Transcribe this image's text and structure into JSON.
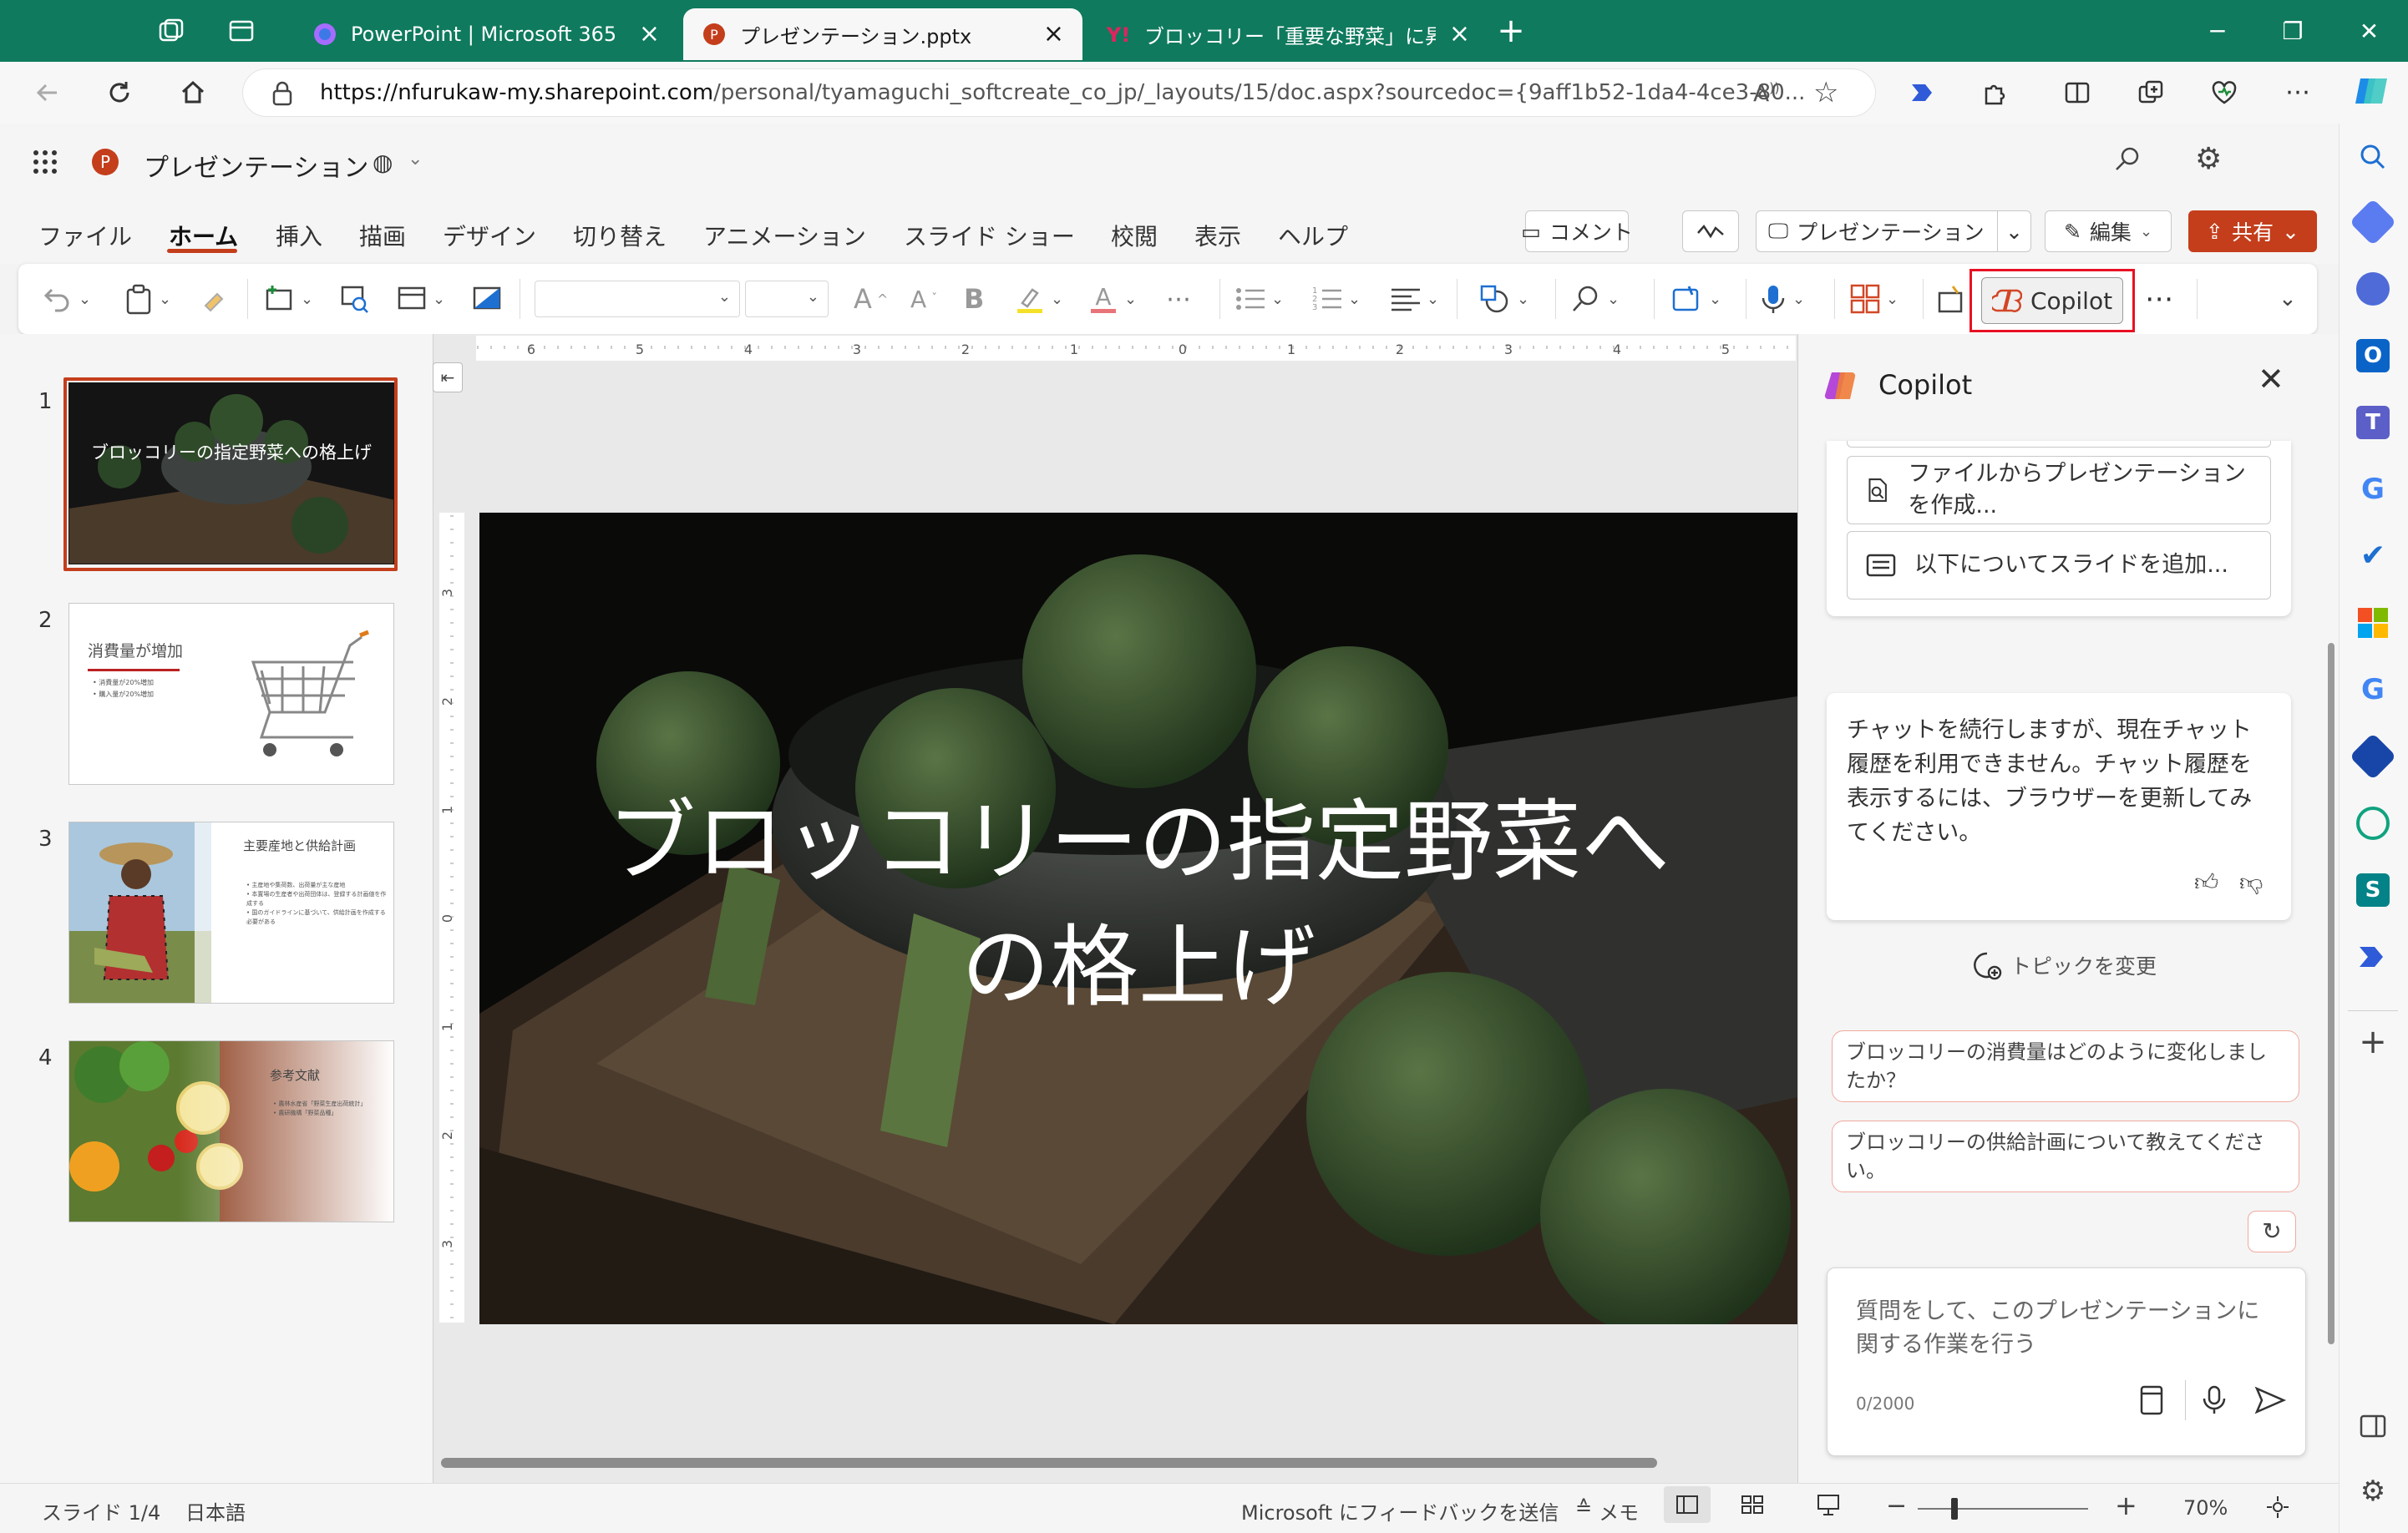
{
  "browser": {
    "tabs": [
      {
        "title": "PowerPoint | Microsoft 365"
      },
      {
        "title": "プレゼンテーション.pptx"
      },
      {
        "title": "ブロッコリー「重要な野菜」に昇格…眼"
      }
    ],
    "url_host": "https://nfurukaw-my.sharepoint.com",
    "url_path": "/personal/tyamaguchi_softcreate_co_jp/_layouts/15/doc.aspx?sourcedoc={9aff1b52-1da4-4ce3-80..."
  },
  "office": {
    "doc_title": "プレゼンテーション",
    "menu_tabs": [
      "ファイル",
      "ホーム",
      "挿入",
      "描画",
      "デザイン",
      "切り替え",
      "アニメーション",
      "スライド ショー",
      "校閲",
      "表示",
      "ヘルプ"
    ],
    "selected_tab": "ホーム",
    "comment_label": "コメント",
    "present_label": "プレゼンテーション",
    "edit_label": "編集",
    "share_label": "共有",
    "copilot_button": "Copilot"
  },
  "thumbnails": [
    {
      "num": "1",
      "title": "ブロッコリーの指定野菜への格上げ"
    },
    {
      "num": "2",
      "title": "消費量が増加",
      "bullets": [
        "• 消費量が20%増加",
        "• 購入量が20%増加"
      ]
    },
    {
      "num": "3",
      "title": "主要産地と供給計画",
      "bullets": [
        "• 主産地や集荷数、出荷量が主な産地",
        "• 本置場の生産者や出荷団体は、登録する計画値を作成する",
        "• 国のガイドラインに基づいて、供給計画を作成する必要がある"
      ]
    },
    {
      "num": "4",
      "title": "参考文献",
      "bullets": [
        "• 農林水産省「野菜生産出荷統計」",
        "• 農研機構「野菜品種」"
      ]
    }
  ],
  "slide": {
    "title_line1": "ブロッコリーの指定野菜へ",
    "title_line2": "の格上げ"
  },
  "ruler": {
    "h_ticks": [
      "6",
      "5",
      "4",
      "3",
      "2",
      "1",
      "0",
      "1",
      "2",
      "3",
      "4",
      "5"
    ],
    "v_ticks": [
      "3",
      "2",
      "1",
      "0",
      "1",
      "2",
      "3"
    ]
  },
  "copilot": {
    "title": "Copilot",
    "option1": "ファイルからプレゼンテーションを作成...",
    "option2": "以下についてスライドを追加...",
    "message": "チャットを続行しますが、現在チャット履歴を利用できません。チャット履歴を表示するには、ブラウザーを更新してみてください。",
    "change_topic": "トピックを変更",
    "suggestions": [
      "ブロッコリーの消費量はどのように変化しましたか？",
      "ブロッコリーの供給計画について教えてください。"
    ],
    "input_placeholder": "質問をして、このプレゼンテーションに関する作業を行う",
    "char_count": "0/2000"
  },
  "status": {
    "slide_info": "スライド 1/4",
    "language": "日本語",
    "feedback": "Microsoft にフィードバックを送信",
    "notes": "メモ",
    "zoom": "70%"
  },
  "colors": {
    "tabstrip": "#0f7a5e",
    "accent": "#c43e1c",
    "highlight_box": "#e81123"
  }
}
